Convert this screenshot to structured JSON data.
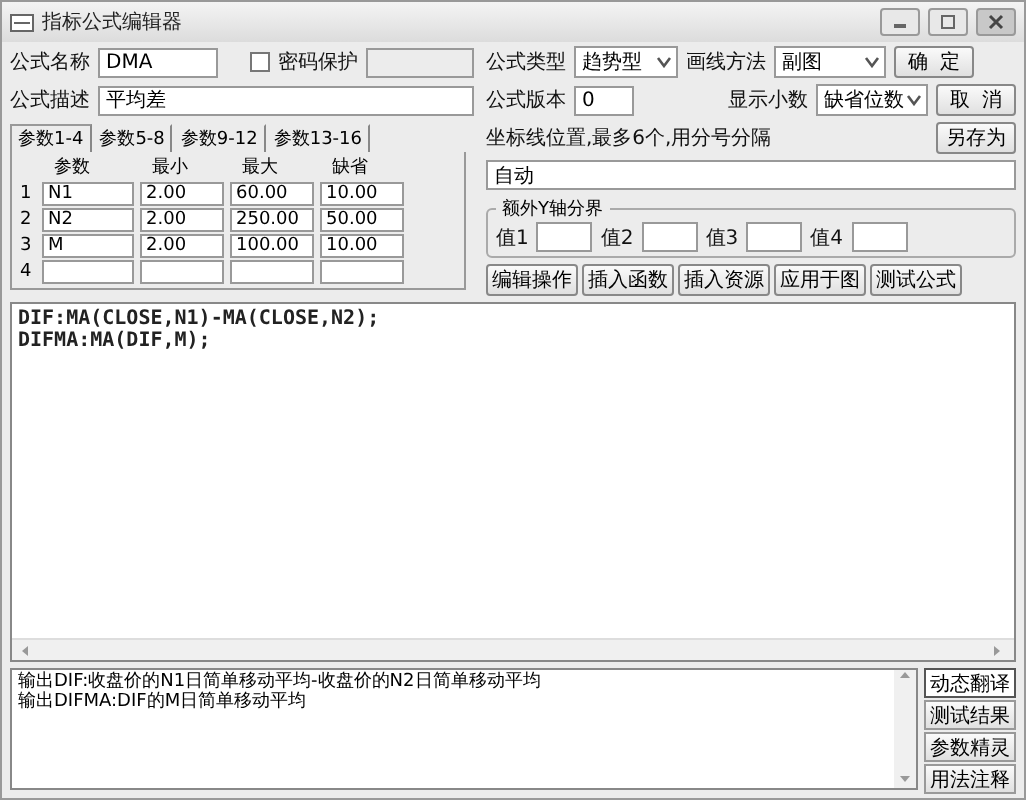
{
  "window": {
    "title": "指标公式编辑器"
  },
  "formula": {
    "name_label": "公式名称",
    "name": "DMA",
    "password": {
      "label": "密码保护",
      "checked": false
    },
    "description_label": "公式描述",
    "description": "平均差",
    "type_label": "公式类型",
    "type": "趋势型",
    "draw_label": "画线方法",
    "draw": "副图",
    "version_label": "公式版本",
    "version": "0",
    "decimals_label": "显示小数",
    "decimals": "缺省位数"
  },
  "actions": [
    "确  定",
    "取  消"
  ],
  "save_as": "另存为",
  "param_tabs": [
    {
      "label": "参数1-4",
      "selected": true
    },
    {
      "label": "参数5-8",
      "selected": false
    },
    {
      "label": "参数9-12",
      "selected": false
    },
    {
      "label": "参数13-16",
      "selected": false
    }
  ],
  "params": {
    "columns": [
      "参数",
      "最小",
      "最大",
      "缺省"
    ],
    "rows": [
      {
        "index": "1",
        "cells": [
          "N1",
          "2.00",
          "60.00",
          "10.00"
        ]
      },
      {
        "index": "2",
        "cells": [
          "N2",
          "2.00",
          "250.00",
          "50.00"
        ]
      },
      {
        "index": "3",
        "cells": [
          "M",
          "2.00",
          "100.00",
          "10.00"
        ]
      },
      {
        "index": "4"
      }
    ]
  },
  "axis": {
    "label": "坐标线位置,最多6个,用分号分隔",
    "value": "自动"
  },
  "y_bounds": {
    "title": "额外Y轴分界",
    "fields": [
      {
        "label": "值1"
      },
      {
        "label": "值2"
      },
      {
        "label": "值3"
      },
      {
        "label": "值4"
      }
    ]
  },
  "tools": [
    "编辑操作",
    "插入函数",
    "插入资源",
    "应用于图",
    "测试公式"
  ],
  "code": [
    "DIF:MA(CLOSE,N1)-MA(CLOSE,N2);",
    "DIFMA:MA(DIF,M);"
  ],
  "notes": [
    "输出DIF:收盘价的N1日简单移动平均-收盘价的N2日简单移动平均",
    "输出DIFMA:DIF的M日简单移动平均"
  ],
  "side_buttons": [
    {
      "label": "动态翻译",
      "selected": true
    },
    {
      "label": "测试结果",
      "selected": false
    },
    {
      "label": "参数精灵",
      "selected": false
    },
    {
      "label": "用法注释",
      "selected": false
    }
  ]
}
